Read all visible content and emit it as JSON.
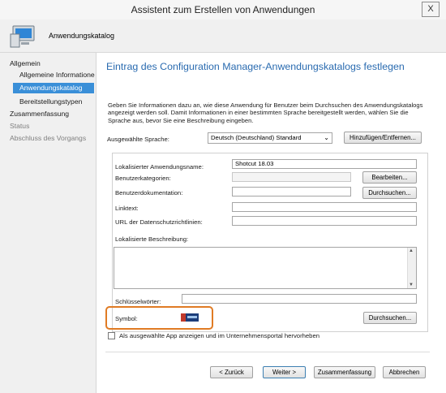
{
  "window": {
    "title": "Assistent zum Erstellen von Anwendungen",
    "close_label": "X"
  },
  "header": {
    "wizard_title": "Anwendungskatalog"
  },
  "sidebar": {
    "items": [
      {
        "label": "Allgemein"
      },
      {
        "label": "Allgemeine Informatione"
      },
      {
        "label": "Anwendungskatalog"
      },
      {
        "label": "Bereitstellungstypen"
      },
      {
        "label": "Zusammenfassung"
      },
      {
        "label": "Status"
      },
      {
        "label": "Abschluss des Vorgangs"
      }
    ]
  },
  "main": {
    "page_title": "Eintrag des Configuration Manager-Anwendungskatalogs festlegen",
    "description": "Geben Sie Informationen dazu an, wie diese Anwendung für Benutzer beim Durchsuchen des Anwendungskatalogs angezeigt werden soll. Damit Informationen in einer bestimmten Sprache bereitgestellt werden, wählen Sie die Sprache aus, bevor Sie eine Beschreibung eingeben.",
    "language_label": "Ausgewählte Sprache:",
    "language_value": "Deutsch (Deutschland) Standard",
    "add_remove_button": "Hinzufügen/Entfernen...",
    "localized_name_label": "Lokalisierter Anwendungsname:",
    "localized_name_value": "Shotcut 18.03",
    "categories_label": "Benutzerkategorien:",
    "edit_button": "Bearbeiten...",
    "documentation_label": "Benutzerdokumentation:",
    "browse_button": "Durchsuchen...",
    "linktext_label": "Linktext:",
    "privacy_url_label": "URL der Datenschutzrichtlinien:",
    "localized_description_label": "Lokalisierte Beschreibung:",
    "keywords_label": "Schlüsselwörter:",
    "symbol_label": "Symbol:",
    "symbol_browse_button": "Durchsuchen...",
    "featured_checkbox_label": "Als ausgewählte App anzeigen und im Unternehmensportal hervorheben"
  },
  "footer": {
    "back_button": "< Zurück",
    "next_button": "Weiter >",
    "summary_button": "Zusammenfassung",
    "cancel_button": "Abbrechen"
  },
  "colors": {
    "accent": "#3a8fd8",
    "title": "#2a6bb0",
    "highlight": "#e07b24"
  }
}
